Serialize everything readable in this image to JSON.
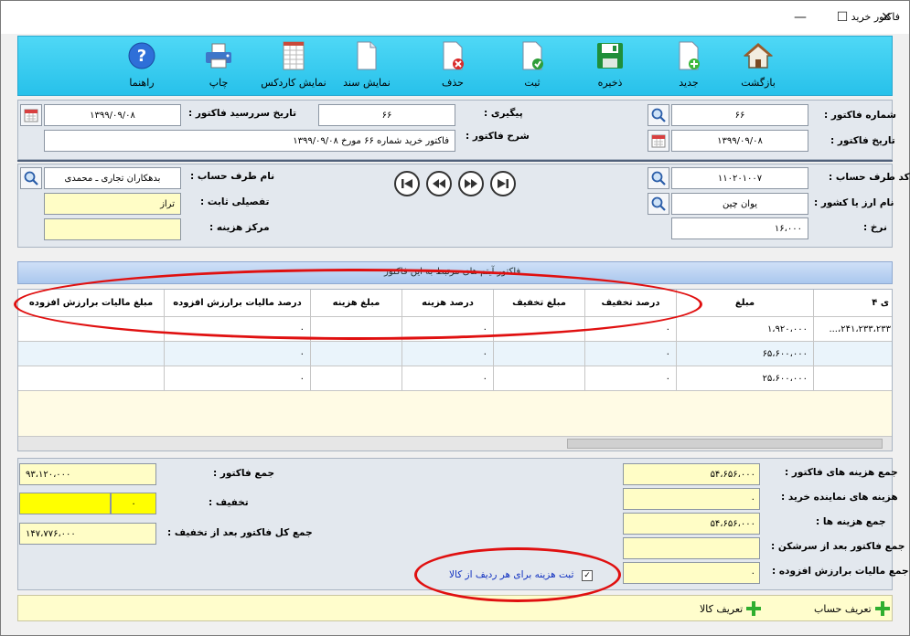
{
  "window": {
    "title": "فاکتور خرید",
    "min": "—",
    "max": "☐",
    "close": "✕"
  },
  "toolbar": [
    {
      "key": "back",
      "label": "بازگشت",
      "icon": "home-icon"
    },
    {
      "key": "new",
      "label": "جدید",
      "icon": "new-document-icon"
    },
    {
      "key": "save",
      "label": "ذخیره",
      "icon": "save-icon"
    },
    {
      "key": "post",
      "label": "ثبت",
      "icon": "check-document-icon"
    },
    {
      "key": "delete",
      "label": "حذف",
      "icon": "delete-document-icon"
    },
    {
      "key": "show_doc",
      "label": "نمایش سند",
      "icon": "document-icon"
    },
    {
      "key": "cardex",
      "label": "نمایش کاردکس",
      "icon": "spreadsheet-icon"
    },
    {
      "key": "print",
      "label": "چاپ",
      "icon": "printer-icon"
    },
    {
      "key": "help",
      "label": "راهنما",
      "icon": "help-icon"
    }
  ],
  "header": {
    "invoice_no_label": "شماره فاکتور :",
    "invoice_no": "۶۶",
    "invoice_date_label": "تاریخ فاکتور :",
    "invoice_date": "۱۳۹۹/۰۹/۰۸",
    "tracking_label": "پیگیری :",
    "tracking": "۶۶",
    "due_date_label": "تاریخ سررسید فاکتور :",
    "due_date": "۱۳۹۹/۰۹/۰۸",
    "description_label": "شرح فاکتور :",
    "description": "فاکتور خرید شماره ۶۶ مورخ ۱۳۹۹/۰۹/۰۸"
  },
  "account": {
    "code_label": "کد طرف حساب :",
    "code": "۱۱۰۲۰۱۰۰۷",
    "currency_label": "نام ارز یا کشور :",
    "currency": "یوان چین",
    "rate_label": "نرخ :",
    "rate": "۱۶،۰۰۰",
    "party_label": "نام طرف حساب :",
    "party": "بدهکاران تجاری ـ محمدی",
    "detail_label": "تفصیلی ثابت :",
    "detail": "تراز",
    "cost_center_label": "مرکز هزینه :",
    "cost_center": ""
  },
  "band": {
    "text": "فاکتور آیتم های مرتبط به این فاکتور"
  },
  "grid": {
    "columns": [
      "مبلغ مالیات برارزش افزوده",
      "درصد مالیات برارزش افزوده",
      "مبلغ هزینه",
      "درصد هزینه",
      "مبلغ تخفیف",
      "درصد تخفیف",
      "مبلغ",
      "ی ۴"
    ],
    "rows": [
      [
        "",
        "۰",
        "",
        "۰",
        "",
        "۰",
        "۱،۹۲۰،۰۰۰",
        "۲۴۱،۲۳۳،۲۳۳،..."
      ],
      [
        "",
        "۰",
        "",
        "۰",
        "",
        "۰",
        "۶۵،۶۰۰،۰۰۰",
        ""
      ],
      [
        "",
        "۰",
        "",
        "۰",
        "",
        "۰",
        "۲۵،۶۰۰،۰۰۰",
        ""
      ]
    ]
  },
  "totals_left": {
    "invoice_total_label": "جمع فاکتور :",
    "invoice_total": "۹۳،۱۲۰،۰۰۰",
    "discount_label": "تخفیف :",
    "discount": "۰",
    "grand_total_label": "جمع کل فاکتور بعد از تخفیف :",
    "grand_total": "۱۴۷،۷۷۶،۰۰۰"
  },
  "totals_right": {
    "invoice_costs_label": "جمع هزینه های فاکتور :",
    "invoice_costs": "۵۴،۶۵۶،۰۰۰",
    "agent_costs_label": "هزینه های نماینده خرید :",
    "agent_costs": "۰",
    "costs_label": "جمع هزینه ها :",
    "costs": "۵۴،۶۵۶،۰۰۰",
    "after_overhead_label": "جمع فاکتور بعد از سرشکن :",
    "after_overhead": "",
    "vat_total_label": "جمع مالیات برارزش افزوده :",
    "vat_total": "۰"
  },
  "checkbox": {
    "label": "ثبت هزینه برای هر ردیف از کالا",
    "mark": "✓"
  },
  "footer": {
    "define_account": "تعریف حساب",
    "define_goods": "تعریف کالا"
  },
  "colors": {
    "toolbar": "#27c1ea",
    "annotation": "#e01010",
    "yellow_field": "#fffdc6"
  }
}
